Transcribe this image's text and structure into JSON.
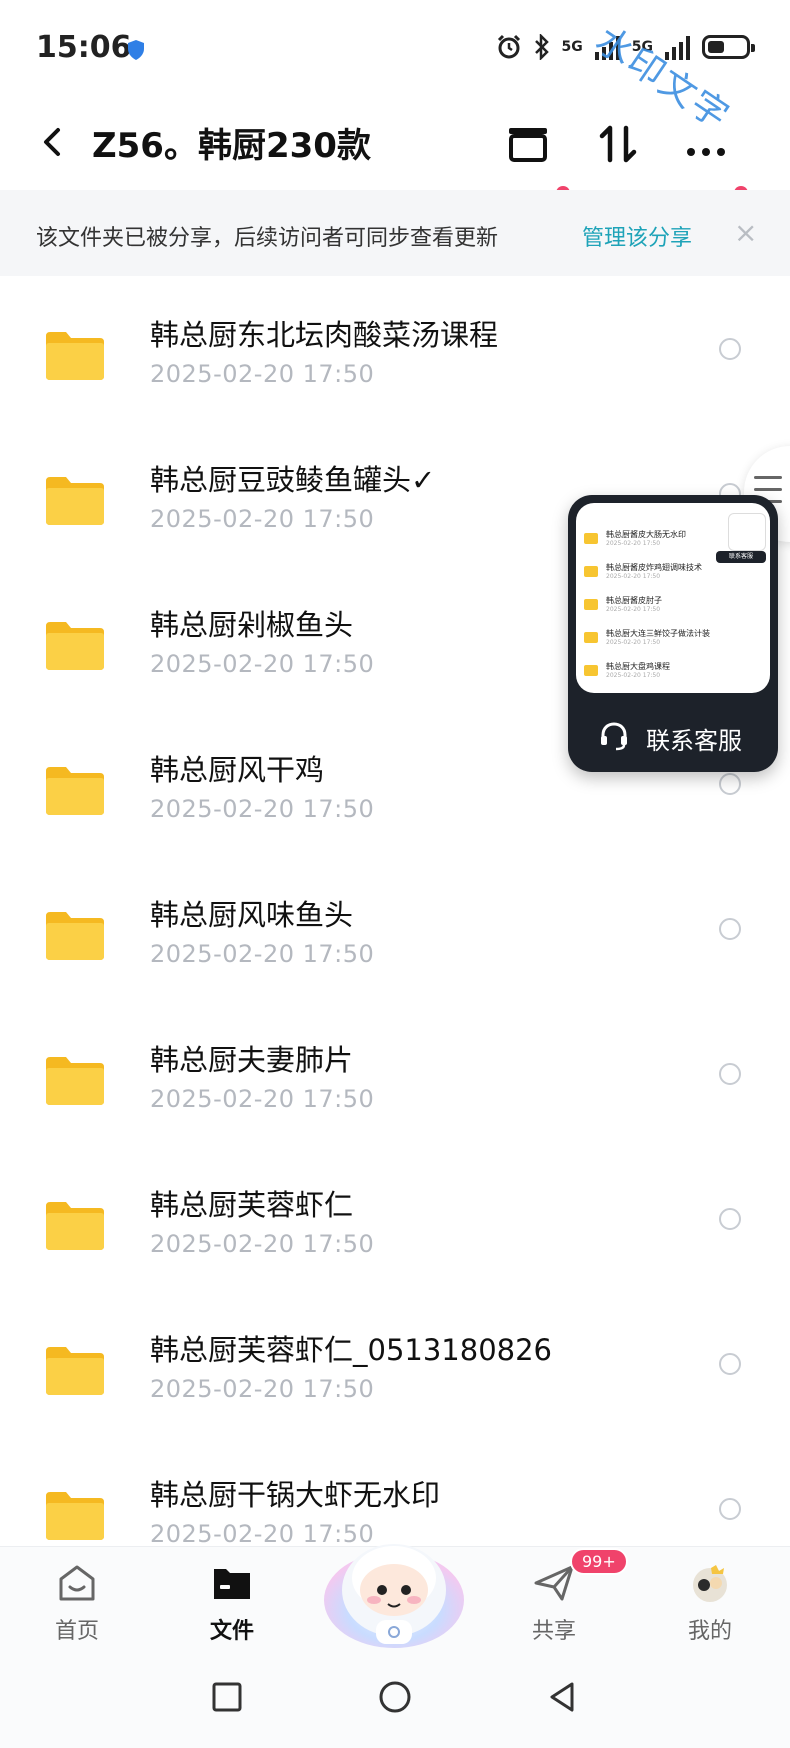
{
  "status_bar": {
    "time": "15:06",
    "network_1": "5G",
    "network_2": "5G",
    "battery_percent": 45,
    "icons": [
      "shield-icon",
      "alarm-icon",
      "bluetooth-icon",
      "signal-icon",
      "battery-icon"
    ],
    "watermark": "水印文字"
  },
  "header": {
    "title": "Z56。韩厨230款",
    "buttons": [
      "back-icon",
      "archive-icon",
      "sort-icon",
      "more-icon"
    ]
  },
  "banner": {
    "message": "该文件夹已被分享，后续访问者可同步查看更新",
    "link": "管理该分享",
    "close": "×"
  },
  "files": [
    {
      "name": "韩总厨东北坛肉酸菜汤课程",
      "date": "2025-02-20  17:50"
    },
    {
      "name": "韩总厨豆豉鲮鱼罐头✓",
      "date": "2025-02-20  17:50"
    },
    {
      "name": "韩总厨剁椒鱼头",
      "date": "2025-02-20  17:50"
    },
    {
      "name": "韩总厨风干鸡",
      "date": "2025-02-20  17:50"
    },
    {
      "name": "韩总厨风味鱼头",
      "date": "2025-02-20  17:50"
    },
    {
      "name": "韩总厨夫妻肺片",
      "date": "2025-02-20  17:50"
    },
    {
      "name": "韩总厨芙蓉虾仁",
      "date": "2025-02-20  17:50"
    },
    {
      "name": "韩总厨芙蓉虾仁_0513180826",
      "date": "2025-02-20  17:50"
    },
    {
      "name": "韩总厨干锅大虾无水印",
      "date": "2025-02-20  17:50"
    }
  ],
  "service_widget": {
    "label": "联系客服",
    "preview_items": [
      {
        "name": "韩总厨酱皮大肠无水印",
        "date": "2025-02-20 17:50"
      },
      {
        "name": "韩总厨酱皮炸鸡翅调味技术",
        "date": "2025-02-20 17:50"
      },
      {
        "name": "韩总厨酱皮肘子",
        "date": "2025-02-20 17:50"
      },
      {
        "name": "韩总厨大连三鲜饺子做法计装",
        "date": "2025-02-20 17:50"
      },
      {
        "name": "韩总厨大盘鸡课程",
        "date": "2025-02-20 17:50"
      }
    ],
    "preview_badge": "联系客服"
  },
  "bottom_nav": {
    "items": [
      {
        "label": "首页",
        "icon": "home-icon"
      },
      {
        "label": "文件",
        "icon": "folder-icon"
      },
      {
        "label": "共享",
        "icon": "send-icon"
      },
      {
        "label": "我的",
        "icon": "avatar-icon"
      }
    ],
    "share_badge": "99+",
    "active": "文件"
  },
  "system_nav": [
    "recent-apps-icon",
    "home-circle-icon",
    "back-triangle-icon"
  ],
  "colors": {
    "accent": "#1ea3b8",
    "badge": "#f0436b",
    "folder": "#f7c531",
    "widget_bg": "#1d222a"
  }
}
